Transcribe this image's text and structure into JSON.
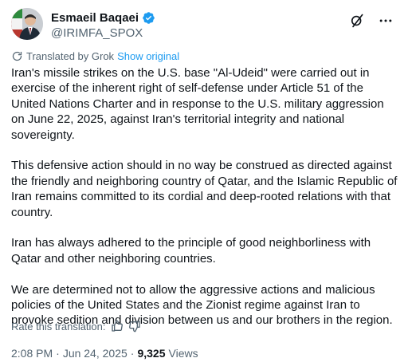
{
  "author": {
    "display_name": "Esmaeil Baqaei",
    "handle": "@IRIMFA_SPOX",
    "verified_color": "#1d9bf0"
  },
  "translation": {
    "label": "Translated by Grok",
    "show_original": "Show original"
  },
  "paragraphs": [
    "Iran's missile strikes on the U.S. base \"Al-Udeid\" were carried out in exercise of the inherent right of self-defense under Article 51 of the United Nations Charter and in response to the U.S. military aggression on June 22, 2025, against Iran's territorial integrity and national sovereignty.",
    "This defensive action should in no way be construed as directed against the friendly and neighboring country of Qatar, and the Islamic Republic of Iran remains committed to its cordial and deep-rooted relations with that country.",
    "Iran has always adhered to the principle of good neighborliness with Qatar and other neighboring countries.",
    "We are determined not to allow the aggressive actions and malicious policies of the United States and the Zionist regime against Iran to provoke sedition and division between us and our brothers in the region."
  ],
  "rate": {
    "label": "Rate this translation:"
  },
  "meta": {
    "time": "2:08 PM",
    "separator": "·",
    "date": "Jun 24, 2025",
    "views_count": "9,325",
    "views_label": "Views"
  },
  "colors": {
    "text": "#0f1419",
    "secondary": "#536471",
    "accent": "#1d9bf0"
  }
}
